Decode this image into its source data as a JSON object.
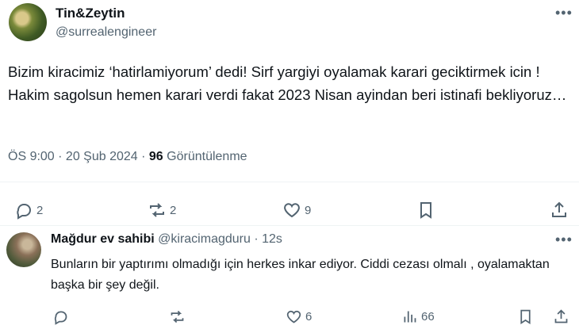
{
  "tweet": {
    "display_name": "Tin&Zeytin",
    "handle": "@surrealengineer",
    "more_icon": "more-icon",
    "text": "Bizim kiracimiz ‘hatirlamiyorum’ dedi! Sirf yargiyi oyalamak karari geciktirmek icin ! Hakim sagolsun hemen karari verdi fakat 2023 Nisan ayindan beri istinafi bekliyoruz…",
    "time": "ÖS 9:00 · 20 Şub 2024 ·",
    "views_count": "96",
    "views_label": "Görüntülenme",
    "actions": {
      "replies": "2",
      "reposts": "2",
      "likes": "9"
    }
  },
  "reply": {
    "display_name": "Mağdur ev sahibi",
    "handle": "@kiracimagduru · 12s",
    "text": "Bunların bir yaptırımı olmadığı için herkes inkar ediyor. Ciddi cezası olmalı , oyalamaktan başka bir şey değil.",
    "actions": {
      "likes": "6",
      "views": "66"
    }
  },
  "colors": {
    "text": "#0f1419",
    "secondary": "#536471",
    "divider": "#eff3f4"
  }
}
